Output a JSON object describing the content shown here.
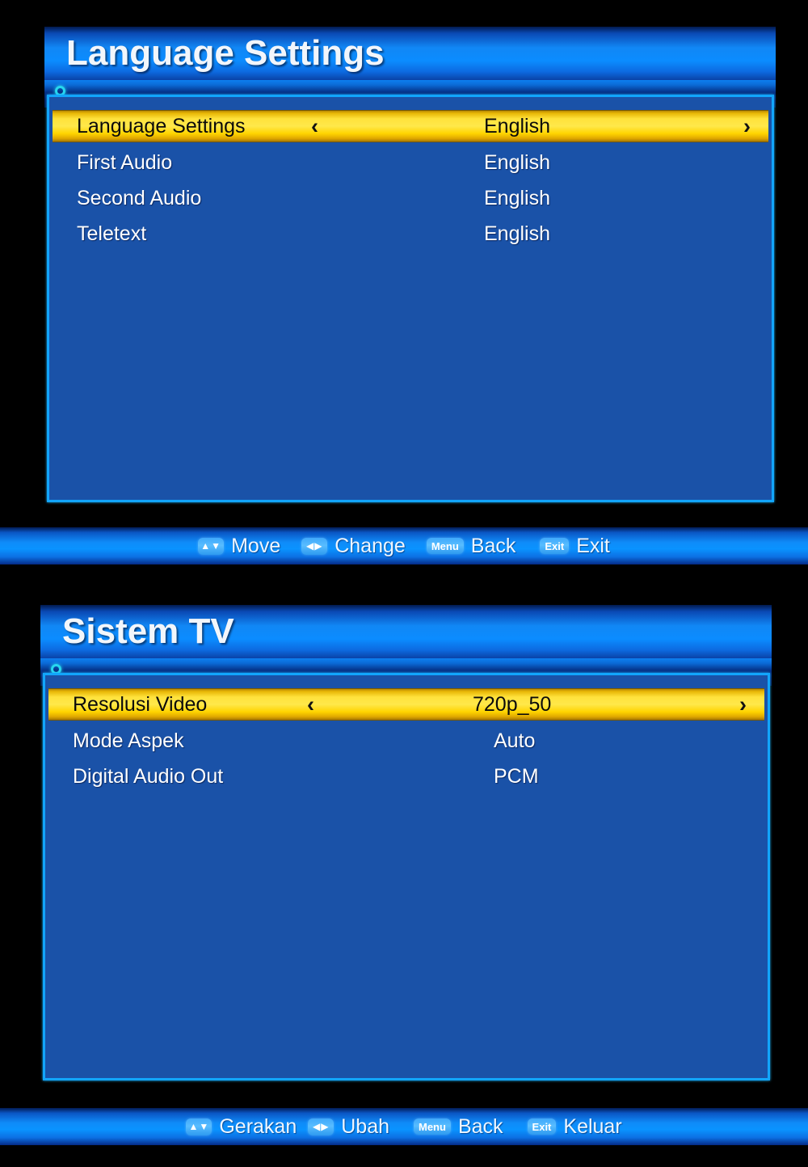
{
  "colors": {
    "panel_blue": "#1a52a8",
    "panel_border": "#12a5fb",
    "highlight_yellow": "#ffe23c",
    "title_blue": "#0b8cff",
    "ring_cyan": "#27d8ef",
    "background": "#000000"
  },
  "screens": [
    {
      "title": "Language Settings",
      "rows": [
        {
          "label": "Language Settings",
          "value": "English",
          "selected": true,
          "left_arrow": "‹",
          "right_arrow": "›"
        },
        {
          "label": "First Audio",
          "value": "English",
          "selected": false
        },
        {
          "label": "Second Audio",
          "value": "English",
          "selected": false
        },
        {
          "label": "Teletext",
          "value": "English",
          "selected": false
        }
      ],
      "help": [
        {
          "key": "▲▼",
          "key_type": "arrows",
          "label": "Move"
        },
        {
          "key": "◀▶",
          "key_type": "arrows",
          "label": "Change"
        },
        {
          "key": "Menu",
          "key_type": "word",
          "label": "Back"
        },
        {
          "key": "Exit",
          "key_type": "word",
          "label": "Exit"
        }
      ]
    },
    {
      "title": "Sistem TV",
      "rows": [
        {
          "label": "Resolusi Video",
          "value": "720p_50",
          "selected": true,
          "left_arrow": "‹",
          "right_arrow": "›"
        },
        {
          "label": "Mode Aspek",
          "value": "Auto",
          "selected": false
        },
        {
          "label": "Digital Audio Out",
          "value": "PCM",
          "selected": false
        }
      ],
      "help": [
        {
          "key": "▲▼",
          "key_type": "arrows",
          "label": "Gerakan"
        },
        {
          "key": "◀▶",
          "key_type": "arrows",
          "label": "Ubah"
        },
        {
          "key": "Menu",
          "key_type": "word",
          "label": "Back"
        },
        {
          "key": "Exit",
          "key_type": "word",
          "label": "Keluar"
        }
      ]
    }
  ]
}
